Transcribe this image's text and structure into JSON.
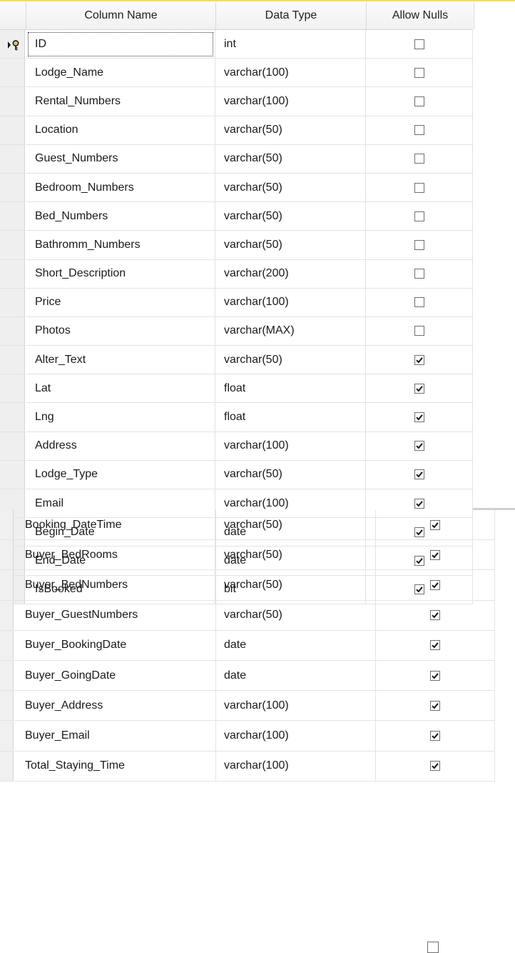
{
  "headers": {
    "column_name": "Column Name",
    "data_type": "Data Type",
    "allow_nulls": "Allow Nulls"
  },
  "colors": {
    "header_top_line": "#f0d878",
    "key_icon": "#e8c22e"
  },
  "top_rows": [
    {
      "name": "ID",
      "type": "int",
      "allow_nulls": false,
      "primary_key": true
    },
    {
      "name": "Lodge_Name",
      "type": "varchar(100)",
      "allow_nulls": false
    },
    {
      "name": "Rental_Numbers",
      "type": "varchar(100)",
      "allow_nulls": false
    },
    {
      "name": "Location",
      "type": "varchar(50)",
      "allow_nulls": false
    },
    {
      "name": "Guest_Numbers",
      "type": "varchar(50)",
      "allow_nulls": false
    },
    {
      "name": "Bedroom_Numbers",
      "type": "varchar(50)",
      "allow_nulls": false
    },
    {
      "name": "Bed_Numbers",
      "type": "varchar(50)",
      "allow_nulls": false
    },
    {
      "name": "Bathromm_Numbers",
      "type": "varchar(50)",
      "allow_nulls": false
    },
    {
      "name": "Short_Description",
      "type": "varchar(200)",
      "allow_nulls": false
    },
    {
      "name": "Price",
      "type": "varchar(100)",
      "allow_nulls": false
    },
    {
      "name": "Photos",
      "type": "varchar(MAX)",
      "allow_nulls": false
    },
    {
      "name": "Alter_Text",
      "type": "varchar(50)",
      "allow_nulls": true
    },
    {
      "name": "Lat",
      "type": "float",
      "allow_nulls": true
    },
    {
      "name": "Lng",
      "type": "float",
      "allow_nulls": true
    },
    {
      "name": "Address",
      "type": "varchar(100)",
      "allow_nulls": true
    },
    {
      "name": "Lodge_Type",
      "type": "varchar(50)",
      "allow_nulls": true
    },
    {
      "name": "Email",
      "type": "varchar(100)",
      "allow_nulls": true
    },
    {
      "name": "Begin_Date",
      "type": "date",
      "allow_nulls": true
    },
    {
      "name": "End_Date",
      "type": "date",
      "allow_nulls": true
    },
    {
      "name": "IsBooked",
      "type": "bit",
      "allow_nulls": true
    }
  ],
  "bottom_rows": [
    {
      "name": "Booking_DateTime",
      "type": "varchar(50)",
      "allow_nulls": true
    },
    {
      "name": "Buyer_BedRooms",
      "type": "varchar(50)",
      "allow_nulls": true
    },
    {
      "name": "Buyer_BedNumbers",
      "type": "varchar(50)",
      "allow_nulls": true
    },
    {
      "name": "Buyer_GuestNumbers",
      "type": "varchar(50)",
      "allow_nulls": true
    },
    {
      "name": "Buyer_BookingDate",
      "type": "date",
      "allow_nulls": true
    },
    {
      "name": "Buyer_GoingDate",
      "type": "date",
      "allow_nulls": true
    },
    {
      "name": "Buyer_Address",
      "type": "varchar(100)",
      "allow_nulls": true
    },
    {
      "name": "Buyer_Email",
      "type": "varchar(100)",
      "allow_nulls": true
    },
    {
      "name": "Total_Staying_Time",
      "type": "varchar(100)",
      "allow_nulls": true
    }
  ]
}
